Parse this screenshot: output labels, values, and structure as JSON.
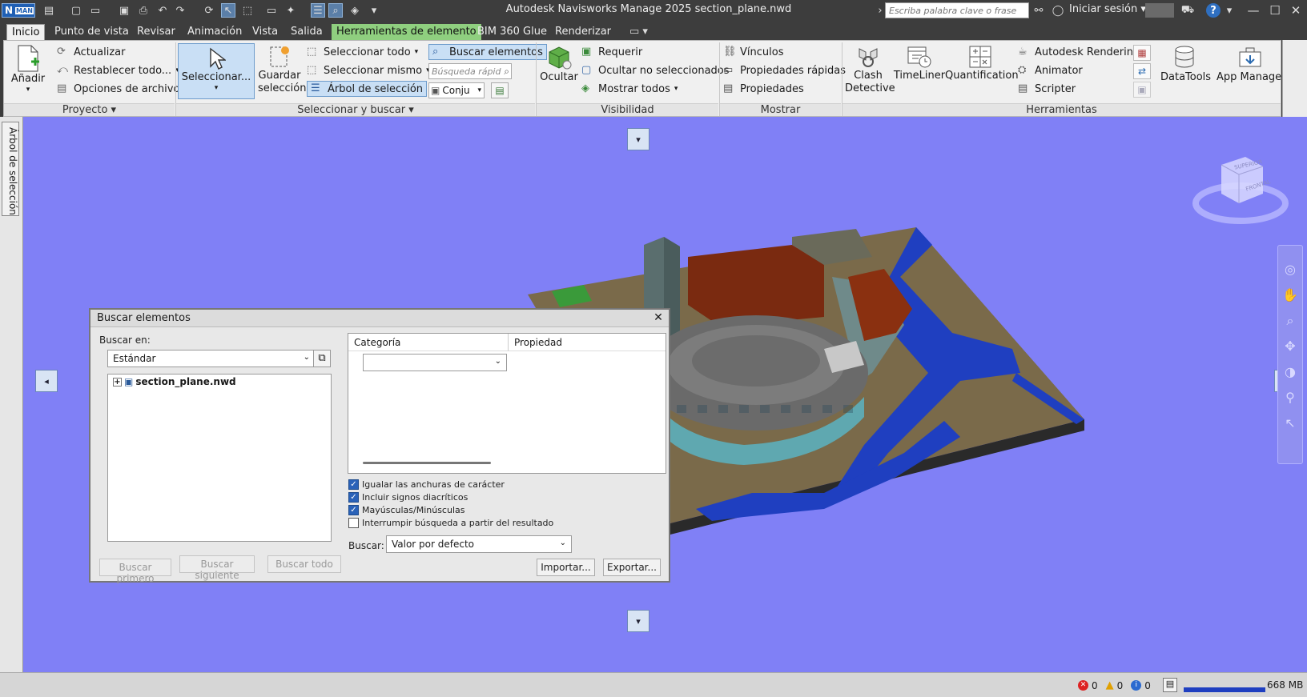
{
  "window": {
    "title": "Autodesk Navisworks Manage 2025    section_plane.nwd",
    "logo": "N",
    "logo_sub": "MAN",
    "search_placeholder": "Escriba palabra clave o frase",
    "signin": "Iniciar sesión",
    "help": "?"
  },
  "tabs": [
    "Inicio",
    "Punto de vista",
    "Revisar",
    "Animación",
    "Vista",
    "Salida",
    "Herramientas de elemento",
    "BIM 360 Glue",
    "Renderizar"
  ],
  "ribbon": {
    "proyecto": {
      "add": "Añadir",
      "refresh": "Actualizar",
      "reset_all": "Restablecer todo...",
      "file_options": "Opciones de archivo",
      "panel": "Proyecto"
    },
    "seleccionar": {
      "select": "Seleccionar...",
      "save_sel_1": "Guardar",
      "save_sel_2": "selección",
      "select_all": "Seleccionar todo",
      "select_same": "Seleccionar mismo",
      "selection_tree": "Árbol de selección",
      "find_items": "Buscar elementos",
      "quick_search": "Búsqueda rápid",
      "sets": "Conju",
      "panel": "Seleccionar y buscar"
    },
    "visibilidad": {
      "hide": "Ocultar",
      "require": "Requerir",
      "hide_unselected": "Ocultar no seleccionados",
      "show_all": "Mostrar todos",
      "panel": "Visibilidad"
    },
    "mostrar": {
      "links": "Vínculos",
      "quick_props": "Propiedades rápidas",
      "props": "Propiedades",
      "panel": "Mostrar"
    },
    "herramientas": {
      "clash_1": "Clash",
      "clash_2": "Detective",
      "timeliner": "TimeLiner",
      "quantification": "Quantification",
      "autodesk_rendering": "Autodesk Rendering",
      "animator": "Animator",
      "scripter": "Scripter",
      "datatools": "DataTools",
      "app_manager": "App Manager",
      "panel": "Herramientas"
    }
  },
  "side_tab": "Árbol de selección",
  "viewcube": {
    "top": "SUPERIOR",
    "front": "FRONTAL"
  },
  "dialog": {
    "title": "Buscar elementos",
    "search_in_label": "Buscar en:",
    "search_in_value": "Estándar",
    "tree_item": "section_plane.nwd",
    "col_category": "Categoría",
    "col_property": "Propiedad",
    "options": [
      {
        "label": "Igualar las anchuras de carácter",
        "checked": true
      },
      {
        "label": "Incluir signos diacríticos",
        "checked": true
      },
      {
        "label": "Mayúsculas/Minúsculas",
        "checked": true
      },
      {
        "label": "Interrumpir búsqueda a partir del resultado",
        "checked": false
      }
    ],
    "search_label": "Buscar:",
    "search_value": "Valor por defecto",
    "find_first": "Buscar primero",
    "find_next": "Buscar siguiente",
    "find_all": "Buscar todo",
    "import": "Importar...",
    "export": "Exportar..."
  },
  "status": {
    "errors": "0",
    "warnings": "0",
    "infos": "0",
    "memory": "668 MB"
  },
  "colors": {
    "viewport_bg": "#8080f6",
    "ribbon_bg": "#f0f0f0",
    "context_tab": "#8fcf7f",
    "titlebar": "#3d3d3d"
  }
}
